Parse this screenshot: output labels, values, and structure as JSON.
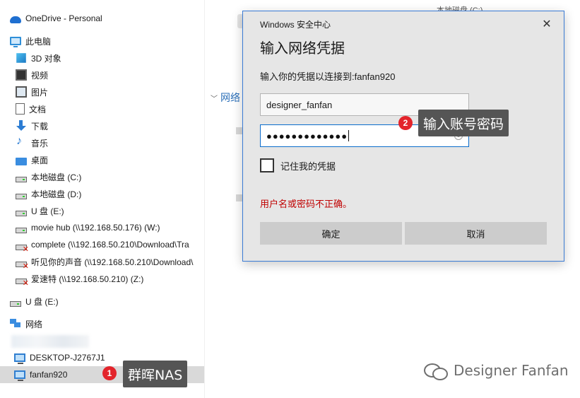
{
  "nav": {
    "items": [
      {
        "label": "OneDrive - Personal",
        "icon": "onedrive-cloud-icon"
      },
      {
        "label": "此电脑",
        "icon": "this-pc-icon"
      },
      {
        "label": "3D 对象",
        "icon": "3d-objects-icon"
      },
      {
        "label": "视频",
        "icon": "videos-icon"
      },
      {
        "label": "图片",
        "icon": "pictures-icon"
      },
      {
        "label": "文档",
        "icon": "documents-icon"
      },
      {
        "label": "下载",
        "icon": "downloads-icon"
      },
      {
        "label": "音乐",
        "icon": "music-icon"
      },
      {
        "label": "桌面",
        "icon": "desktop-icon"
      },
      {
        "label": "本地磁盘 (C:)",
        "icon": "local-disk-icon"
      },
      {
        "label": "本地磁盘 (D:)",
        "icon": "local-disk-icon"
      },
      {
        "label": "U 盘 (E:)",
        "icon": "usb-drive-icon"
      },
      {
        "label": "movie hub (\\\\192.168.50.176) (W:)",
        "icon": "network-drive-icon"
      },
      {
        "label": "complete (\\\\192.168.50.210\\Download\\Tra",
        "icon": "disconnected-network-drive-icon"
      },
      {
        "label": "听见你的声音 (\\\\192.168.50.210\\Download\\",
        "icon": "disconnected-network-drive-icon"
      },
      {
        "label": "爱速特 (\\\\192.168.50.210) (Z:)",
        "icon": "disconnected-network-drive-icon"
      },
      {
        "label": "U 盘 (E:)",
        "icon": "usb-drive-icon"
      },
      {
        "label": "网络",
        "icon": "network-icon"
      },
      {
        "label": "DESKTOP-J2767J1",
        "icon": "computer-icon"
      },
      {
        "label": "fanfan920",
        "icon": "computer-icon"
      }
    ]
  },
  "background": {
    "local_disk_label": "本地磁盘 (C:)",
    "network_group": "网络"
  },
  "dialog": {
    "caption": "Windows 安全中心",
    "title": "输入网络凭据",
    "prompt": "输入你的凭据以连接到:fanfan920",
    "username": "designer_fanfan",
    "password_mask": "●●●●●●●●●●●●●",
    "remember_label": "记住我的凭据",
    "error": "用户名或密码不正确。",
    "ok_label": "确定",
    "cancel_label": "取消",
    "close_glyph": "✕"
  },
  "annotations": {
    "badge1": "1",
    "callout1": "群晖NAS",
    "badge2": "2",
    "callout2": "输入账号密码"
  },
  "watermark": "Designer Fanfan",
  "colors": {
    "accent": "#0a6ccc",
    "error": "#c00000",
    "badge": "#e3242b",
    "callout_bg": "#555555"
  }
}
